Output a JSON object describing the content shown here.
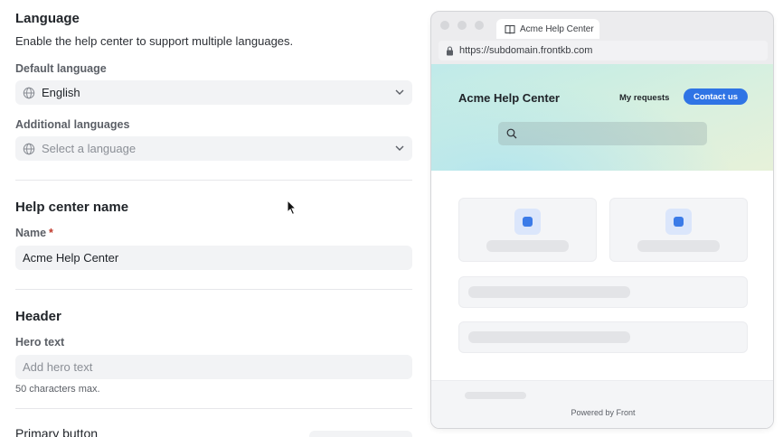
{
  "language": {
    "title": "Language",
    "description": "Enable the help center to support multiple languages.",
    "default_label": "Default language",
    "default_value": "English",
    "additional_label": "Additional languages",
    "additional_placeholder": "Select a language"
  },
  "help_center_name": {
    "title": "Help center name",
    "name_label": "Name",
    "required_mark": "*",
    "name_value": "Acme Help Center"
  },
  "header": {
    "title": "Header",
    "hero_label": "Hero text",
    "hero_placeholder": "Add hero text",
    "hero_hint": "50 characters max.",
    "primary_button_label": "Primary button"
  },
  "preview": {
    "tab_title": "Acme Help Center",
    "url": "https://subdomain.frontkb.com",
    "brand": "Acme Help Center",
    "my_requests": "My requests",
    "contact_us": "Contact us",
    "powered_by": "Powered by Front",
    "accent_color": "#2f74e5"
  },
  "icons": {
    "globe": "globe-icon",
    "chevron": "chevron-down-icon",
    "lock": "lock-icon",
    "book": "book-icon",
    "search": "search-icon",
    "cursor": "mouse-cursor-icon"
  }
}
